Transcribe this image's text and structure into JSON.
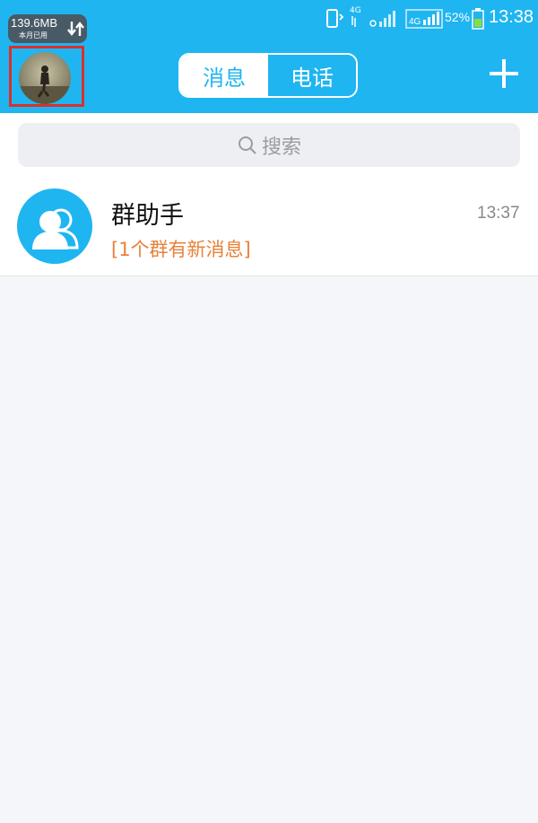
{
  "status_bar": {
    "data_usage": "139.6MB",
    "data_usage_label": "本月已用",
    "network_label": "4G",
    "battery_percent": "52%",
    "time": "13:38"
  },
  "header": {
    "tabs": [
      {
        "label": "消息",
        "active": true
      },
      {
        "label": "电话",
        "active": false
      }
    ],
    "add_icon": "plus-icon",
    "accent_color": "#1fb5f1",
    "highlight_color": "#d9302c"
  },
  "search": {
    "placeholder": "搜索"
  },
  "conversations": [
    {
      "name": "群助手",
      "preview": "[1个群有新消息]",
      "time": "13:37",
      "icon": "group-icon"
    }
  ]
}
